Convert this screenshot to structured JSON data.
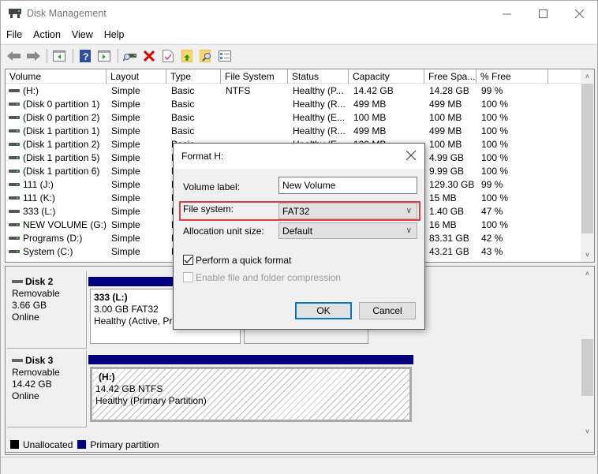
{
  "window": {
    "title": "Disk Management",
    "controls": {
      "minimize": "minimize-icon",
      "maximize": "maximize-icon",
      "close": "close-icon"
    }
  },
  "menu": [
    "File",
    "Action",
    "View",
    "Help"
  ],
  "toolbar": {
    "buttons": [
      "back-arrow-icon",
      "forward-arrow-icon",
      "show-hide-console-tree-icon",
      "help-icon",
      "show-hide-action-pane-icon",
      "connect-drive-icon",
      "delete-icon",
      "properties-icon",
      "import-icon",
      "search-icon",
      "checklist-icon"
    ]
  },
  "volume_list": {
    "columns": [
      "Volume",
      "Layout",
      "Type",
      "File System",
      "Status",
      "Capacity",
      "Free Spa...",
      "% Free"
    ],
    "rows": [
      [
        "(H:)",
        "Simple",
        "Basic",
        "NTFS",
        "Healthy (P...",
        "14.42 GB",
        "14.28 GB",
        "99 %"
      ],
      [
        "(Disk 0 partition 1)",
        "Simple",
        "Basic",
        "",
        "Healthy (R...",
        "499 MB",
        "499 MB",
        "100 %"
      ],
      [
        "(Disk 0 partition 2)",
        "Simple",
        "Basic",
        "",
        "Healthy (E...",
        "100 MB",
        "100 MB",
        "100 %"
      ],
      [
        "(Disk 1 partition 1)",
        "Simple",
        "Basic",
        "",
        "Healthy (R...",
        "499 MB",
        "499 MB",
        "100 %"
      ],
      [
        "(Disk 1 partition 2)",
        "Simple",
        "Basic",
        "",
        "Healthy (E...",
        "100 MB",
        "100 MB",
        "100 %"
      ],
      [
        "(Disk 1 partition 5)",
        "Simple",
        "Basic",
        "",
        "",
        "",
        "4.99 GB",
        "100 %"
      ],
      [
        "(Disk 1 partition 6)",
        "Simple",
        "Basic",
        "",
        "",
        "",
        "9.99 GB",
        "100 %"
      ],
      [
        "111 (J:)",
        "Simple",
        "Basic",
        "",
        "",
        "",
        "129.30 GB",
        "99 %"
      ],
      [
        "111 (K:)",
        "Simple",
        "Basic",
        "",
        "",
        "",
        "15 MB",
        "100 %"
      ],
      [
        "333 (L:)",
        "Simple",
        "Basic",
        "",
        "",
        "",
        "1.40 GB",
        "47 %"
      ],
      [
        "NEW VOLUME (G:)",
        "Simple",
        "Basic",
        "",
        "",
        "",
        "16 MB",
        "100 %"
      ],
      [
        "Programs (D:)",
        "Simple",
        "Basic",
        "",
        "",
        "",
        "83.31 GB",
        "42 %"
      ],
      [
        "System (C:)",
        "Simple",
        "Basic",
        "",
        "",
        "",
        "43.21 GB",
        "43 %"
      ]
    ]
  },
  "disks": [
    {
      "name": "Disk 2",
      "type": "Removable",
      "size": "3.66 GB",
      "state": "Online",
      "partition": {
        "label": "333  (L:)",
        "detail": "3.00 GB FAT32",
        "status": "Healthy (Active, Pri"
      }
    },
    {
      "name": "Disk 3",
      "type": "Removable",
      "size": "14.42 GB",
      "state": "Online",
      "partition": {
        "label": "(H:)",
        "detail": "14.42 GB NTFS",
        "status": "Healthy (Primary Partition)"
      }
    }
  ],
  "legend": [
    {
      "label": "Unallocated",
      "color": "#000000"
    },
    {
      "label": "Primary partition",
      "color": "#000080"
    }
  ],
  "dialog": {
    "title": "Format H:",
    "volume_label_text": "Volume label:",
    "volume_label_value": "New Volume",
    "file_system_text": "File system:",
    "file_system_value": "FAT32",
    "allocation_text": "Allocation unit size:",
    "allocation_value": "Default",
    "quick_format_label": "Perform a quick format",
    "quick_format_checked": true,
    "compression_label": "Enable file and folder compression",
    "compression_checked": false,
    "ok_label": "OK",
    "cancel_label": "Cancel",
    "highlight_color": "#e53c3c"
  }
}
